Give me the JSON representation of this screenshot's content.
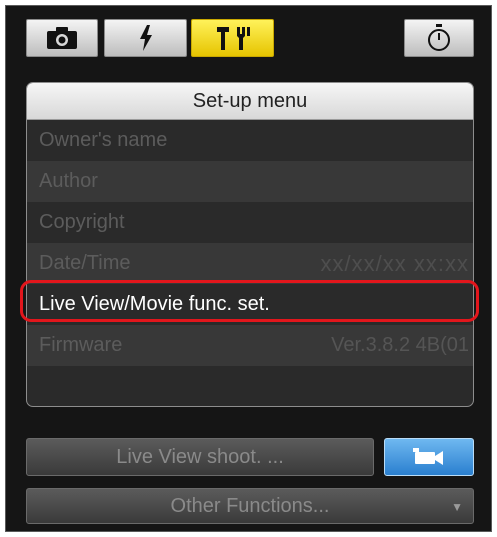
{
  "tabs": [
    {
      "icon": "camera-icon",
      "active": false
    },
    {
      "icon": "flash-icon",
      "active": false
    },
    {
      "icon": "tools-icon",
      "active": true
    },
    {
      "icon": "timer-icon",
      "active": false
    }
  ],
  "setup_menu": {
    "title": "Set-up menu",
    "items": [
      {
        "label": "Owner's name",
        "value": ""
      },
      {
        "label": "Author",
        "value": ""
      },
      {
        "label": "Copyright",
        "value": ""
      },
      {
        "label": "Date/Time",
        "value": "xx/xx/xx xx:xx"
      },
      {
        "label": "Live View/Movie func. set.",
        "value": "",
        "selected": true
      },
      {
        "label": "Firmware",
        "value": "Ver.3.8.2 4B(01"
      }
    ]
  },
  "bottom": {
    "live_view_label": "Live View shoot. ...",
    "movie_button_icon": "movie-camera-icon",
    "other_functions_label": "Other Functions...",
    "other_functions_arrow": "▼"
  },
  "colors": {
    "active_tab": "#f1d400",
    "highlight_outline": "#e2161c",
    "movie_button": "#3b8fd8"
  }
}
